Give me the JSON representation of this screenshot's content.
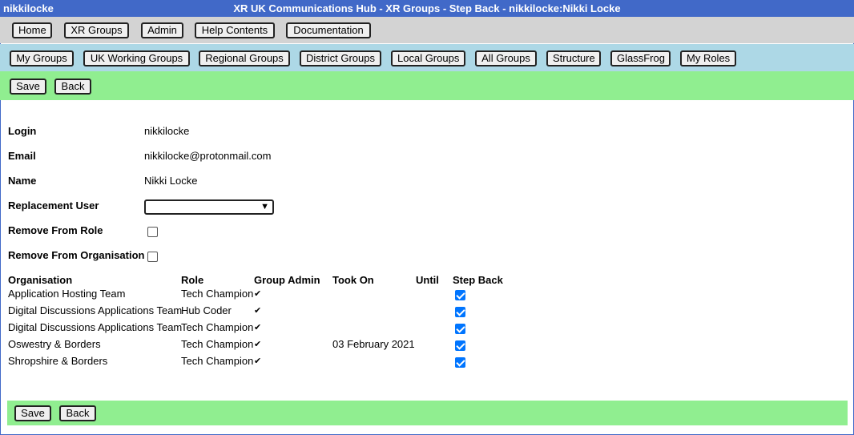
{
  "window": {
    "user": "nikkilocke",
    "title": "XR UK Communications Hub - XR Groups - Step Back - nikkilocke:Nikki Locke"
  },
  "main_nav": [
    "Home",
    "XR Groups",
    "Admin",
    "Help Contents",
    "Documentation"
  ],
  "group_nav": [
    "My Groups",
    "UK Working Groups",
    "Regional Groups",
    "District Groups",
    "Local Groups",
    "All Groups",
    "Structure",
    "GlassFrog",
    "My Roles"
  ],
  "actions": {
    "save": "Save",
    "back": "Back"
  },
  "form": {
    "login_label": "Login",
    "login_value": "nikkilocke",
    "email_label": "Email",
    "email_value": "nikkilocke@protonmail.com",
    "name_label": "Name",
    "name_value": "Nikki Locke",
    "replacement_label": "Replacement User",
    "replacement_value": "",
    "remove_role_label": "Remove From Role",
    "remove_role_checked": false,
    "remove_org_label": "Remove From Organisation",
    "remove_org_checked": false
  },
  "table": {
    "headers": [
      "Organisation",
      "Role",
      "Group Admin",
      "Took On",
      "Until",
      "Step Back"
    ],
    "rows": [
      {
        "organisation": "Application Hosting Team",
        "role": "Tech Champion",
        "group_admin": "✔",
        "took_on": "",
        "until": "",
        "step_back": true
      },
      {
        "organisation": "Digital Discussions Applications Team",
        "role": "Hub Coder",
        "group_admin": "✔",
        "took_on": "",
        "until": "",
        "step_back": true
      },
      {
        "organisation": "Digital Discussions Applications Team",
        "role": "Tech Champion",
        "group_admin": "✔",
        "took_on": "",
        "until": "",
        "step_back": true
      },
      {
        "organisation": "Oswestry & Borders",
        "role": "Tech Champion",
        "group_admin": "✔",
        "took_on": "03 February 2021",
        "until": "",
        "step_back": true
      },
      {
        "organisation": "Shropshire & Borders",
        "role": "Tech Champion",
        "group_admin": "✔",
        "took_on": "",
        "until": "",
        "step_back": true
      }
    ]
  },
  "colors": {
    "title_bar": "#4169c8",
    "main_nav_bg": "#d3d3d3",
    "group_nav_bg": "#add8e6",
    "action_bar_bg": "#90ee90",
    "checkbox_checked": "#0075ff"
  }
}
